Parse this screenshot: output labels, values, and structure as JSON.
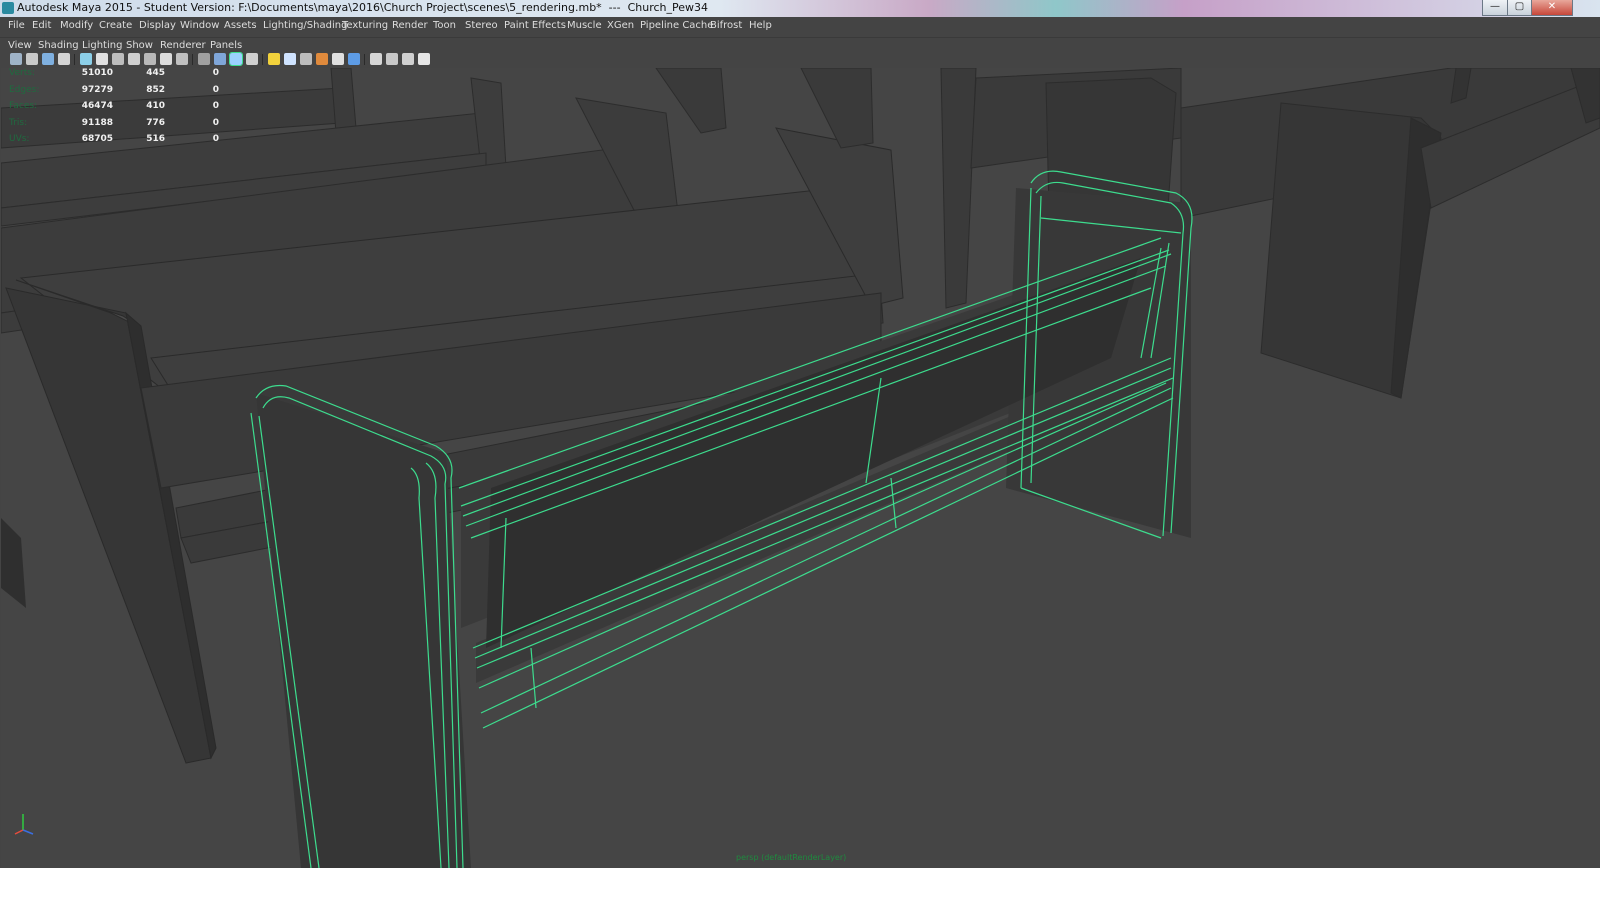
{
  "window": {
    "title": "Autodesk Maya 2015 - Student Version: F:\\Documents\\maya\\2016\\Church Project\\scenes\\5_rendering.mb*  ---  Church_Pew34",
    "minimize": "—",
    "maximize": "▢",
    "close": "✕"
  },
  "menubar": [
    "File",
    "Edit",
    "Modify",
    "Create",
    "Display",
    "Window",
    "Assets",
    "Lighting/Shading",
    "Texturing",
    "Render",
    "Toon",
    "Stereo",
    "Paint Effects",
    "Muscle",
    "XGen",
    "Pipeline Cache",
    "Bifrost",
    "Help"
  ],
  "panel_menu": [
    "View",
    "Shading",
    "Lighting",
    "Show",
    "Renderer",
    "Panels"
  ],
  "toolbar_icons": [
    "select-camera-icon",
    "camera-attributes-icon",
    "bookmark-icon",
    "image-plane-icon",
    "grid-icon",
    "film-gate-icon",
    "resolution-gate-icon",
    "gate-mask-icon",
    "field-chart-icon",
    "safe-action-icon",
    "safe-title-icon",
    "wireframe-icon",
    "smooth-shade-icon",
    "wireframe-on-shaded-icon",
    "textured-icon",
    "use-all-lights-icon",
    "shadows-icon",
    "screen-space-ao-icon",
    "motion-blur-icon",
    "anti-aliasing-icon",
    "depth-of-field-icon",
    "isolate-select-icon",
    "xray-icon",
    "xray-joints-icon",
    "xray-components-icon"
  ],
  "hud": {
    "rows": [
      {
        "label": "Verts:",
        "c1": "51010",
        "c2": "445",
        "c3": "0"
      },
      {
        "label": "Edges:",
        "c1": "97279",
        "c2": "852",
        "c3": "0"
      },
      {
        "label": "Faces:",
        "c1": "46474",
        "c2": "410",
        "c3": "0"
      },
      {
        "label": "Tris:",
        "c1": "91188",
        "c2": "776",
        "c3": "0"
      },
      {
        "label": "UVs:",
        "c1": "68705",
        "c2": "516",
        "c3": "0"
      }
    ]
  },
  "viewport": {
    "camera_label": "persp (defaultRenderLayer)"
  },
  "colors": {
    "selection_wire": "#3ddc8e",
    "mesh_fill": "#3a3a3a",
    "viewport_bg": "#444444"
  }
}
